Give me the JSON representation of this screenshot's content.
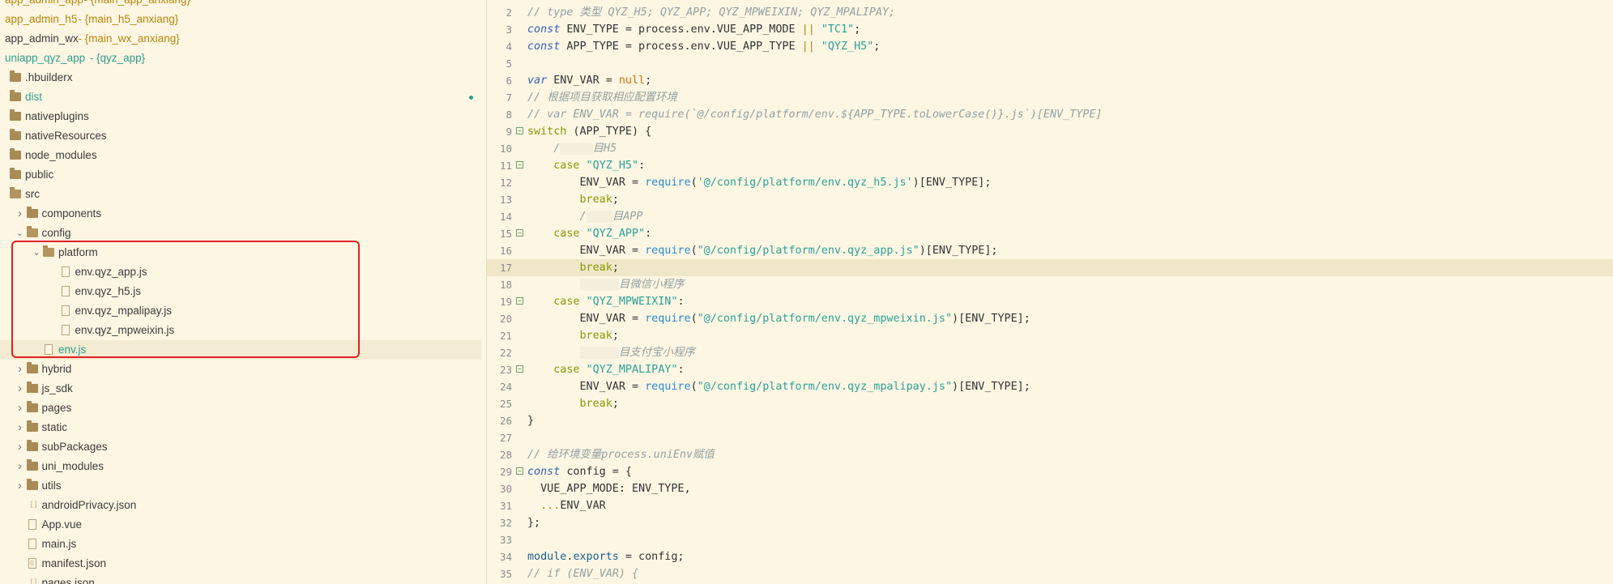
{
  "explorer": {
    "rows": [
      {
        "label": "app_admin_app",
        "branch": "main_app_anxiang",
        "indent": 0,
        "kind": "project",
        "style": "orange"
      },
      {
        "label": "app_admin_h5",
        "branch": "main_h5_anxiang",
        "indent": 0,
        "kind": "project",
        "style": "orange"
      },
      {
        "label": "app_admin_wx",
        "branch": "main_wx_anxiang",
        "indent": 0,
        "kind": "project",
        "style": "normal"
      },
      {
        "label": "uniapp_qyz_app",
        "branch": "qyz_app",
        "indent": 0,
        "kind": "project",
        "style": "green"
      },
      {
        "label": ".hbuilderx",
        "indent": 0,
        "kind": "folder"
      },
      {
        "label": "dist",
        "indent": 0,
        "kind": "folder",
        "style": "green",
        "dot": true
      },
      {
        "label": "nativeplugins",
        "indent": 0,
        "kind": "folder"
      },
      {
        "label": "nativeResources",
        "indent": 0,
        "kind": "folder"
      },
      {
        "label": "node_modules",
        "indent": 0,
        "kind": "folder"
      },
      {
        "label": "public",
        "indent": 0,
        "kind": "folder"
      },
      {
        "label": "src",
        "indent": 0,
        "kind": "folder-open"
      },
      {
        "label": "components",
        "indent": 1,
        "kind": "folder",
        "chevron": "collapsed"
      },
      {
        "label": "config",
        "indent": 1,
        "kind": "folder-open",
        "chevron": "expanded"
      },
      {
        "label": "platform",
        "indent": 2,
        "kind": "folder-open",
        "chevron": "expanded"
      },
      {
        "label": "env.qyz_app.js",
        "indent": 3,
        "kind": "file"
      },
      {
        "label": "env.qyz_h5.js",
        "indent": 3,
        "kind": "file"
      },
      {
        "label": "env.qyz_mpalipay.js",
        "indent": 3,
        "kind": "file"
      },
      {
        "label": "env.qyz_mpweixin.js",
        "indent": 3,
        "kind": "file"
      },
      {
        "label": "env.js",
        "indent": 2,
        "kind": "file",
        "style": "green",
        "selected": true
      },
      {
        "label": "hybrid",
        "indent": 1,
        "kind": "folder",
        "chevron": "collapsed"
      },
      {
        "label": "js_sdk",
        "indent": 1,
        "kind": "folder",
        "chevron": "collapsed"
      },
      {
        "label": "pages",
        "indent": 1,
        "kind": "folder",
        "chevron": "collapsed"
      },
      {
        "label": "static",
        "indent": 1,
        "kind": "folder",
        "chevron": "collapsed"
      },
      {
        "label": "subPackages",
        "indent": 1,
        "kind": "folder",
        "chevron": "collapsed"
      },
      {
        "label": "uni_modules",
        "indent": 1,
        "kind": "folder",
        "chevron": "collapsed"
      },
      {
        "label": "utils",
        "indent": 1,
        "kind": "folder",
        "chevron": "collapsed"
      },
      {
        "label": "androidPrivacy.json",
        "indent": 1,
        "kind": "json"
      },
      {
        "label": "App.vue",
        "indent": 1,
        "kind": "file"
      },
      {
        "label": "main.js",
        "indent": 1,
        "kind": "file"
      },
      {
        "label": "manifest.json",
        "indent": 1,
        "kind": "json-obj"
      },
      {
        "label": "pages.json",
        "indent": 1,
        "kind": "json"
      }
    ]
  },
  "editor": {
    "current_line": 17,
    "lines": [
      {
        "n": "2",
        "tokens": [
          [
            "cm",
            "// type 类型 QYZ_H5; QYZ_APP; QYZ_MPWEIXIN; QYZ_MPALIPAY;"
          ]
        ]
      },
      {
        "n": "3",
        "tokens": [
          [
            "kw",
            "const"
          ],
          [
            "",
            " ENV_TYPE = process.env.VUE_APP_MODE "
          ],
          [
            "op",
            "||"
          ],
          [
            "",
            " "
          ],
          [
            "str",
            "\"TC1\""
          ],
          [
            "",
            ";"
          ]
        ]
      },
      {
        "n": "4",
        "tokens": [
          [
            "kw",
            "const"
          ],
          [
            "",
            " APP_TYPE = process.env.VUE_APP_TYPE "
          ],
          [
            "op",
            "||"
          ],
          [
            "",
            " "
          ],
          [
            "str",
            "\"QYZ_H5\""
          ],
          [
            "",
            ";"
          ]
        ]
      },
      {
        "n": "5",
        "tokens": []
      },
      {
        "n": "6",
        "tokens": [
          [
            "kw",
            "var"
          ],
          [
            "",
            " ENV_VAR = "
          ],
          [
            "num",
            "null"
          ],
          [
            "",
            ";"
          ]
        ]
      },
      {
        "n": "7",
        "tokens": [
          [
            "cm",
            "// 根据项目获取相应配置环境"
          ]
        ]
      },
      {
        "n": "8",
        "tokens": [
          [
            "cm",
            "// var ENV_VAR = require(`@/config/platform/env.${APP_TYPE.toLowerCase()}.js`)[ENV_TYPE]"
          ]
        ]
      },
      {
        "n": "9",
        "fold": true,
        "tokens": [
          [
            "kw2",
            "switch"
          ],
          [
            "",
            " (APP_TYPE) {"
          ]
        ]
      },
      {
        "n": "10",
        "tokens": [
          [
            "",
            "    "
          ],
          [
            "cm",
            "/"
          ],
          [
            "mask",
            "     "
          ],
          [
            "cm",
            "目H5"
          ]
        ]
      },
      {
        "n": "11",
        "fold": true,
        "tokens": [
          [
            "",
            "    "
          ],
          [
            "kw2",
            "case"
          ],
          [
            "",
            " "
          ],
          [
            "str",
            "\"QYZ_H5\""
          ],
          [
            "",
            ":"
          ]
        ]
      },
      {
        "n": "12",
        "tokens": [
          [
            "",
            "        ENV_VAR = "
          ],
          [
            "fn",
            "require"
          ],
          [
            "",
            "("
          ],
          [
            "str",
            "'@/config/platform/env.qyz_h5.js'"
          ],
          [
            "",
            ")[ENV_TYPE];"
          ]
        ]
      },
      {
        "n": "13",
        "tokens": [
          [
            "",
            "        "
          ],
          [
            "kw2",
            "break"
          ],
          [
            "",
            ";"
          ]
        ]
      },
      {
        "n": "14",
        "tokens": [
          [
            "",
            "        "
          ],
          [
            "cm",
            "/"
          ],
          [
            "mask",
            "    "
          ],
          [
            "cm",
            "目APP"
          ]
        ]
      },
      {
        "n": "15",
        "fold": true,
        "tokens": [
          [
            "",
            "    "
          ],
          [
            "kw2",
            "case"
          ],
          [
            "",
            " "
          ],
          [
            "str",
            "\"QYZ_APP\""
          ],
          [
            "",
            ":"
          ]
        ]
      },
      {
        "n": "16",
        "tokens": [
          [
            "",
            "        ENV_VAR = "
          ],
          [
            "fn",
            "require"
          ],
          [
            "",
            "("
          ],
          [
            "str",
            "\"@/config/platform/env.qyz_app.js\""
          ],
          [
            "",
            ")[ENV_TYPE];"
          ]
        ]
      },
      {
        "n": "17",
        "tokens": [
          [
            "",
            "        "
          ],
          [
            "kw2",
            "break"
          ],
          [
            "",
            ";"
          ]
        ]
      },
      {
        "n": "18",
        "tokens": [
          [
            "",
            "        "
          ],
          [
            "mask",
            "      "
          ],
          [
            "cm",
            "目微信小程序"
          ]
        ]
      },
      {
        "n": "19",
        "fold": true,
        "tokens": [
          [
            "",
            "    "
          ],
          [
            "kw2",
            "case"
          ],
          [
            "",
            " "
          ],
          [
            "str",
            "\"QYZ_MPWEIXIN\""
          ],
          [
            "",
            ":"
          ]
        ]
      },
      {
        "n": "20",
        "tokens": [
          [
            "",
            "        ENV_VAR = "
          ],
          [
            "fn",
            "require"
          ],
          [
            "",
            "("
          ],
          [
            "str",
            "\"@/config/platform/env.qyz_mpweixin.js\""
          ],
          [
            "",
            ")[ENV_TYPE];"
          ]
        ]
      },
      {
        "n": "21",
        "tokens": [
          [
            "",
            "        "
          ],
          [
            "kw2",
            "break"
          ],
          [
            "",
            ";"
          ]
        ]
      },
      {
        "n": "22",
        "tokens": [
          [
            "",
            "        "
          ],
          [
            "mask",
            "      "
          ],
          [
            "cm",
            "目支付宝小程序"
          ]
        ]
      },
      {
        "n": "23",
        "fold": true,
        "tokens": [
          [
            "",
            "    "
          ],
          [
            "kw2",
            "case"
          ],
          [
            "",
            " "
          ],
          [
            "str",
            "\"QYZ_MPALIPAY\""
          ],
          [
            "",
            ":"
          ]
        ]
      },
      {
        "n": "24",
        "tokens": [
          [
            "",
            "        ENV_VAR = "
          ],
          [
            "fn",
            "require"
          ],
          [
            "",
            "("
          ],
          [
            "str",
            "\"@/config/platform/env.qyz_mpalipay.js\""
          ],
          [
            "",
            ")[ENV_TYPE];"
          ]
        ]
      },
      {
        "n": "25",
        "tokens": [
          [
            "",
            "        "
          ],
          [
            "kw2",
            "break"
          ],
          [
            "",
            ";"
          ]
        ]
      },
      {
        "n": "26",
        "tokens": [
          [
            "",
            "}"
          ]
        ]
      },
      {
        "n": "27",
        "tokens": []
      },
      {
        "n": "28",
        "tokens": [
          [
            "cm",
            "// 给环境变量process.uniEnv赋值"
          ]
        ]
      },
      {
        "n": "29",
        "fold": true,
        "tokens": [
          [
            "kw",
            "const"
          ],
          [
            "",
            " config = {"
          ]
        ]
      },
      {
        "n": "30",
        "tokens": [
          [
            "",
            "  VUE_APP_MODE: ENV_TYPE,"
          ]
        ]
      },
      {
        "n": "31",
        "tokens": [
          [
            "",
            "  "
          ],
          [
            "op",
            "..."
          ],
          [
            "",
            "ENV_VAR"
          ]
        ]
      },
      {
        "n": "32",
        "tokens": [
          [
            "",
            "};"
          ]
        ]
      },
      {
        "n": "33",
        "tokens": []
      },
      {
        "n": "34",
        "tokens": [
          [
            "prop",
            "module"
          ],
          [
            "",
            "."
          ],
          [
            "prop",
            "exports"
          ],
          [
            "",
            " = config;"
          ]
        ]
      },
      {
        "n": "35",
        "tokens": [
          [
            "cm",
            "// if (ENV_VAR) {"
          ]
        ]
      }
    ]
  }
}
